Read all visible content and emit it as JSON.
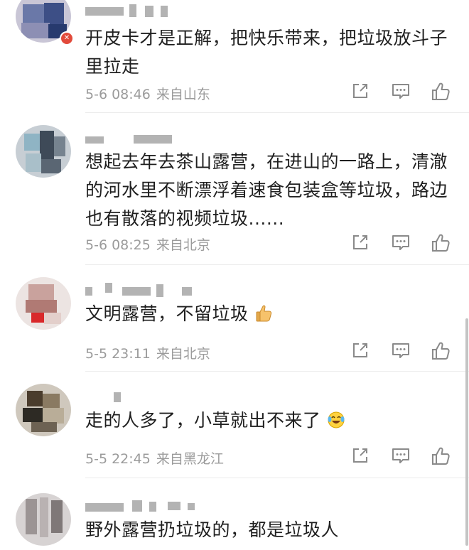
{
  "comments": [
    {
      "text": "开皮卡才是正解，把快乐带来，把垃圾放斗子里拉走",
      "date": "5-6 08:46",
      "location": "来自山东"
    },
    {
      "text": "想起去年去茶山露营，在进山的一路上，清澈的河水里不断漂浮着速食包装盒等垃圾，路边也有散落的视频垃圾......",
      "date": "5-6 08:25",
      "location": "来自北京"
    },
    {
      "text": "文明露营，不留垃圾",
      "emoji": "thumbs-up-emoji",
      "date": "5-5 23:11",
      "location": "来自北京"
    },
    {
      "text": "走的人多了，小草就出不来了",
      "emoji": "laughing-crying-emoji",
      "date": "5-5 22:45",
      "location": "来自黑龙江"
    },
    {
      "text": "野外露营扔垃圾的，都是垃圾人"
    }
  ],
  "icons": {
    "share": "share-icon",
    "comment": "comment-icon",
    "like": "like-icon"
  },
  "colors": {
    "text": "#1f1f1f",
    "meta": "#9b9b9b",
    "icon": "#8a8a8a",
    "badge": "#e24a3b"
  }
}
